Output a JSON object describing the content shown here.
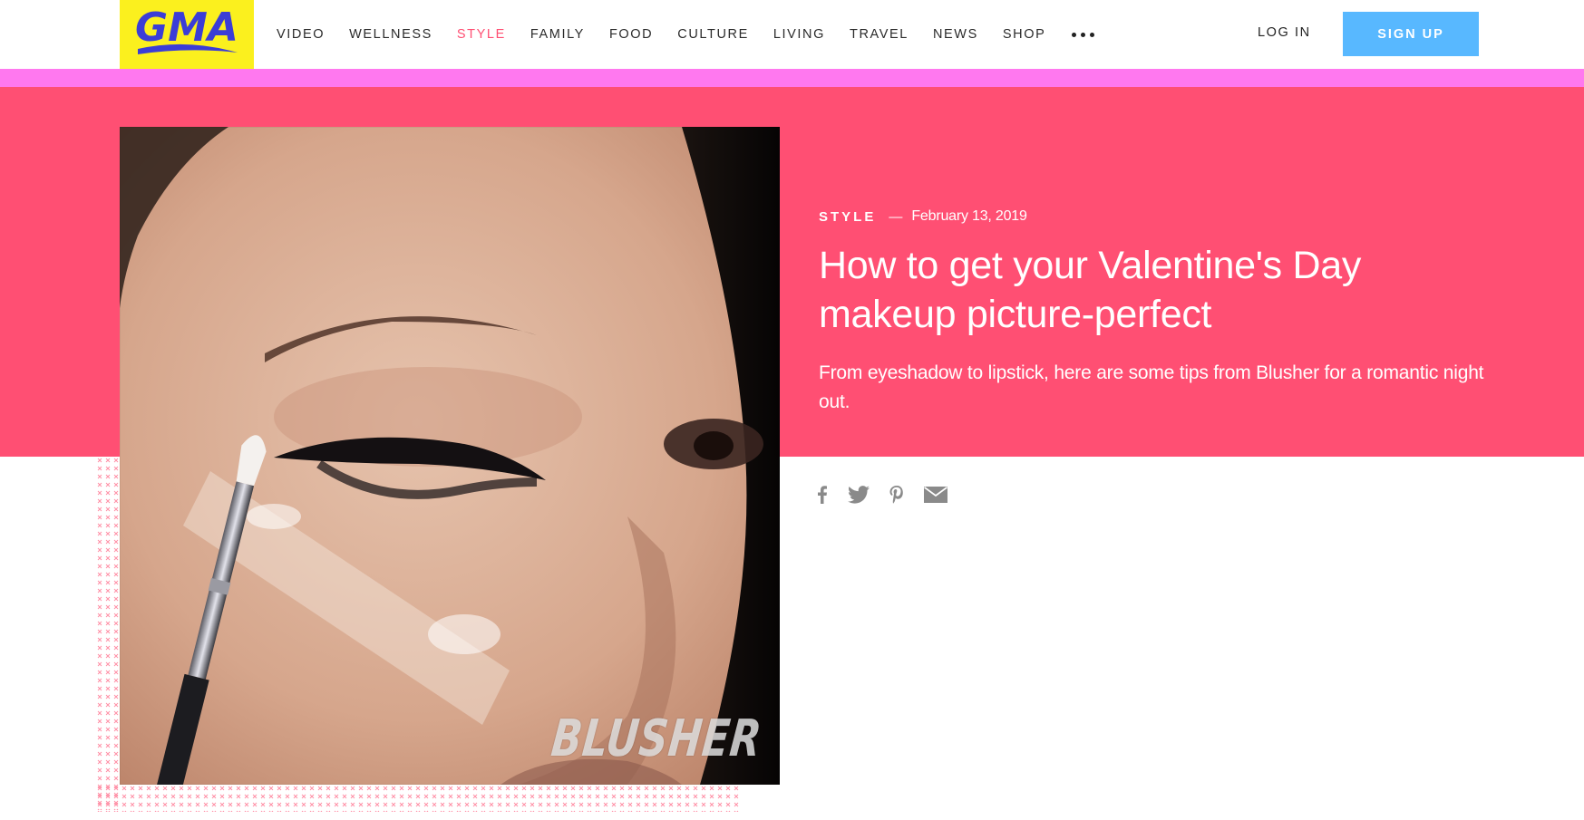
{
  "header": {
    "logo_text": "GMA",
    "nav": [
      {
        "label": "VIDEO",
        "active": false
      },
      {
        "label": "WELLNESS",
        "active": false
      },
      {
        "label": "STYLE",
        "active": true
      },
      {
        "label": "FAMILY",
        "active": false
      },
      {
        "label": "FOOD",
        "active": false
      },
      {
        "label": "CULTURE",
        "active": false
      },
      {
        "label": "LIVING",
        "active": false
      },
      {
        "label": "TRAVEL",
        "active": false
      },
      {
        "label": "NEWS",
        "active": false
      },
      {
        "label": "SHOP",
        "active": false
      }
    ],
    "more_icon": "more-dots-icon",
    "login_label": "LOG IN",
    "signup_label": "SIGN UP"
  },
  "article": {
    "category": "STYLE",
    "separator": "—",
    "date": "February 13, 2019",
    "headline": "How to get your Valentine's Day makeup picture-perfect",
    "dek": "From eyeshadow to lipstick, here are some tips from Blusher for a romantic night out.",
    "image": {
      "watermark": "BLUSHER"
    }
  },
  "share": [
    {
      "name": "facebook",
      "icon": "facebook-icon"
    },
    {
      "name": "twitter",
      "icon": "twitter-icon"
    },
    {
      "name": "pinterest",
      "icon": "pinterest-icon"
    },
    {
      "name": "email",
      "icon": "email-icon"
    }
  ],
  "colors": {
    "brand_yellow": "#fbf01e",
    "brand_blue": "#3b3dd6",
    "hero_pink": "#ff4f73",
    "accent_magenta": "#ff78ef",
    "signup_blue": "#58b8ff",
    "nav_active": "#ff4f73",
    "share_gray": "#8a8a8a"
  }
}
